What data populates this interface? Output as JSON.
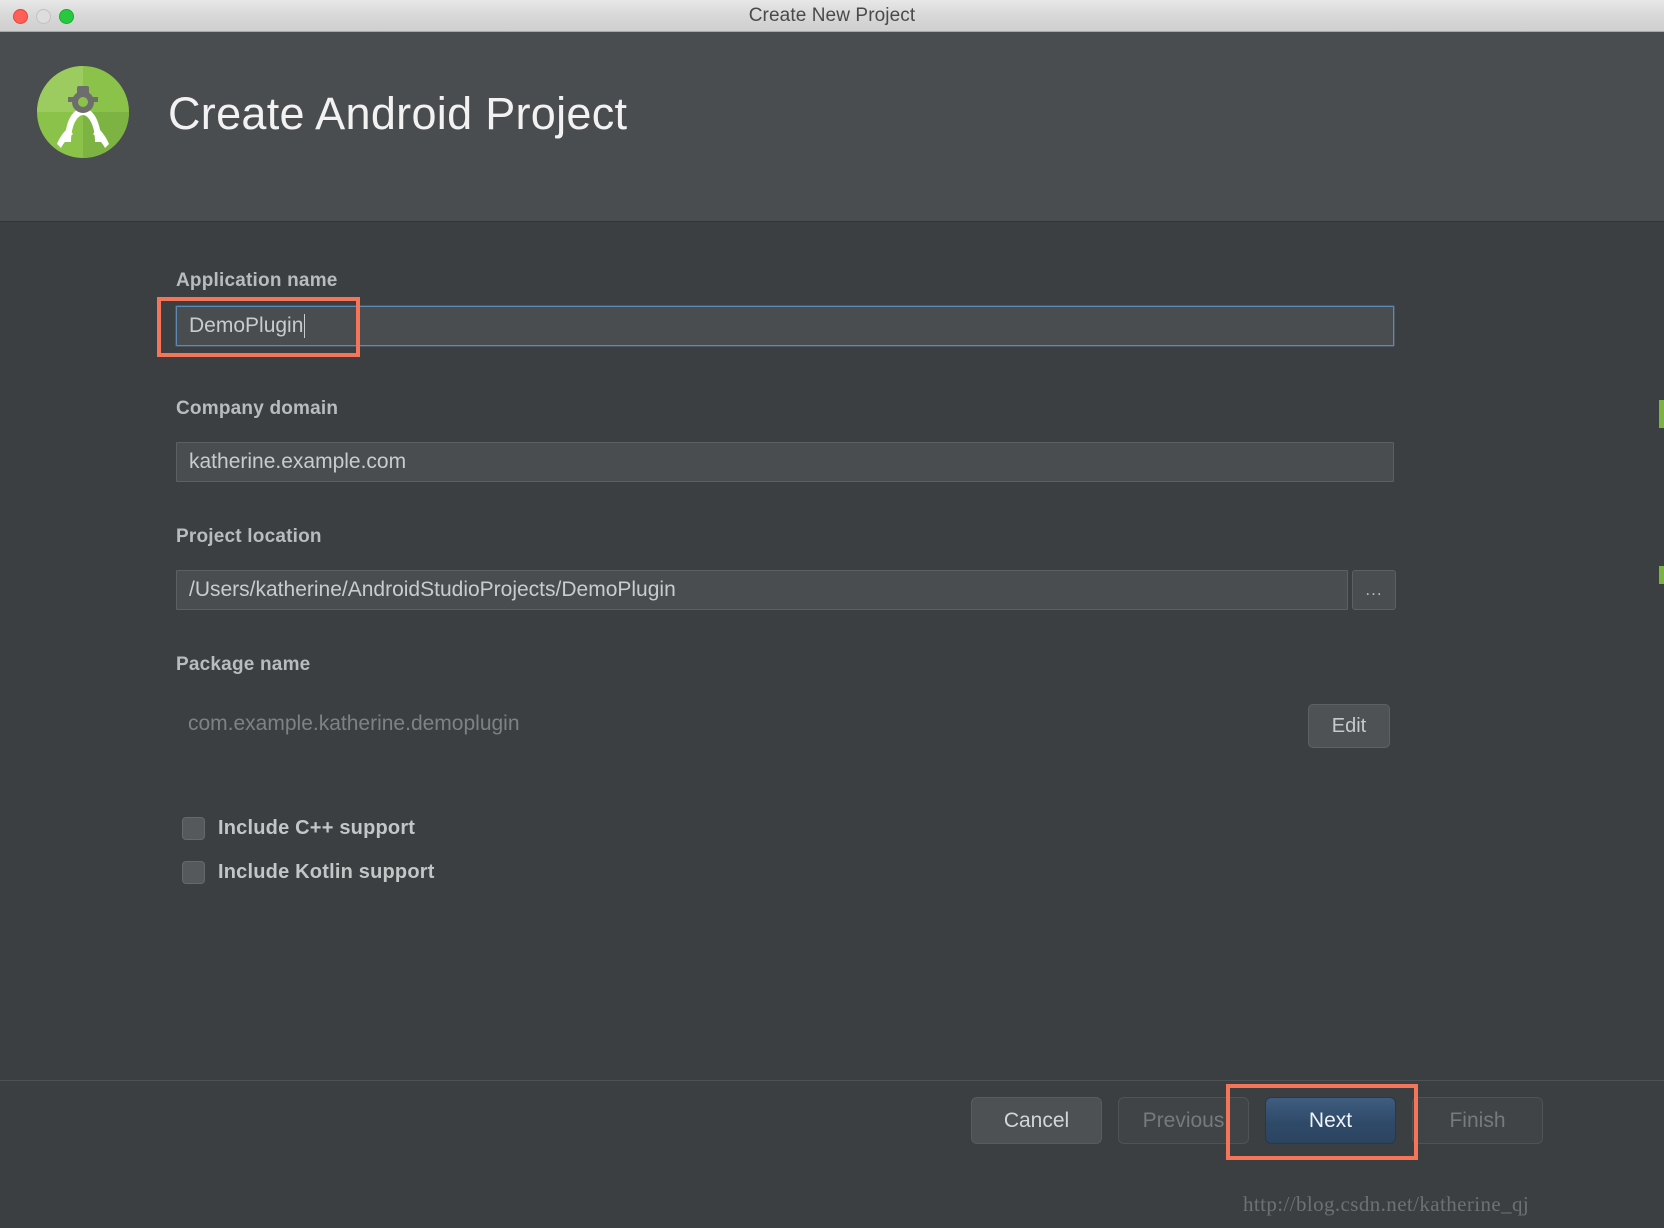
{
  "window": {
    "title": "Create New Project",
    "traffic_lights": [
      "close",
      "minimize",
      "maximize"
    ]
  },
  "header": {
    "title": "Create Android Project",
    "logo_name": "android-studio-logo",
    "logo_color": "#8bc34a"
  },
  "form": {
    "application_name": {
      "label": "Application name",
      "value": "DemoPlugin",
      "focused": true,
      "annotated": true
    },
    "company_domain": {
      "label": "Company domain",
      "value": "katherine.example.com"
    },
    "project_location": {
      "label": "Project location",
      "value": "/Users/katherine/AndroidStudioProjects/DemoPlugin",
      "browse_label": "..."
    },
    "package_name": {
      "label": "Package name",
      "value": "com.example.katherine.demoplugin",
      "edit_label": "Edit",
      "readonly": true
    },
    "checkboxes": [
      {
        "label": "Include C++ support",
        "checked": false
      },
      {
        "label": "Include Kotlin support",
        "checked": false
      }
    ]
  },
  "footer": {
    "buttons": [
      {
        "label": "Cancel",
        "state": "enabled"
      },
      {
        "label": "Previous",
        "state": "disabled"
      },
      {
        "label": "Next",
        "state": "primary"
      },
      {
        "label": "Finish",
        "state": "disabled"
      }
    ]
  },
  "watermark": {
    "text": "http://blog.csdn.net/katherine_qj"
  },
  "annotation": {
    "color": "#f4755a"
  }
}
